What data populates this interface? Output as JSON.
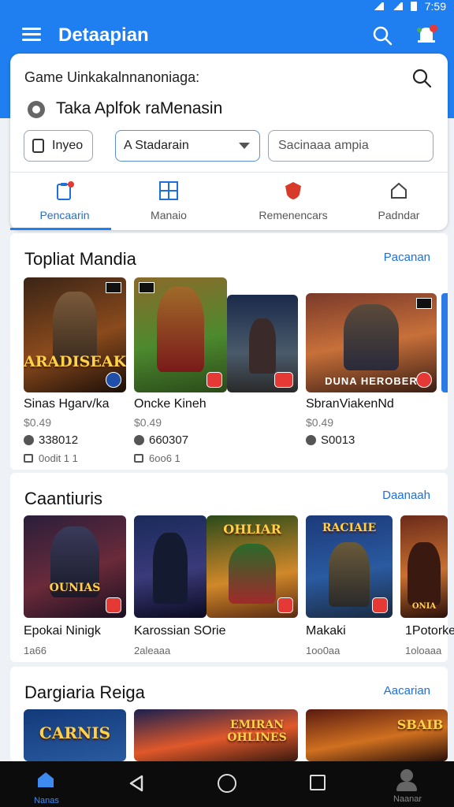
{
  "status_bar": {
    "time": "7:59"
  },
  "app_bar": {
    "title": "Detaapian"
  },
  "search": {
    "label": "Game Uinkakalnnanoniaga:",
    "subtitle": "Taka Aplfok raMenasin",
    "chip_1": "Inyeo",
    "select_value": "A Stadarain",
    "input_placeholder": "Sacinaaa ampia"
  },
  "tabs": [
    {
      "label": "Pencaarin",
      "icon": "clipboard-icon",
      "active": true
    },
    {
      "label": "Manaio",
      "icon": "grid-icon",
      "active": false
    },
    {
      "label": "Remenencars",
      "icon": "shield-icon",
      "active": false
    },
    {
      "label": "Padndar",
      "icon": "home-icon",
      "active": false
    }
  ],
  "sections": [
    {
      "title": "Topliat Mandia",
      "link": "Pacanan",
      "games": [
        {
          "name": "Sinas Hgarv/ka",
          "price": "$0.49",
          "rating": "338012",
          "downloads": "0odit 1 1",
          "art_text": "ARADISEAK",
          "colors": [
            "#2b1a12",
            "#c8762a"
          ]
        },
        {
          "name": "Oncke Kineh",
          "price": "$0.49",
          "rating": "660307",
          "downloads": "6oo6 1",
          "art_text": "",
          "colors": [
            "#4d8a2e",
            "#c04a1a"
          ]
        },
        {
          "name": "SbranViakenNd",
          "price": "$0.49",
          "rating": "S0013",
          "downloads": "",
          "art_text": "DUNA HEROBER",
          "colors": [
            "#5a3020",
            "#e08a40"
          ]
        }
      ]
    },
    {
      "title": "Caantiuris",
      "link": "Daanaah",
      "games": [
        {
          "name": "Epokai Ninigk",
          "meta": "1a66",
          "art_text": "OUNIAS",
          "colors": [
            "#1c1d3a",
            "#b0402a"
          ]
        },
        {
          "name": "Karossian SOrie",
          "meta": "2aleaaa",
          "art_text": "OHLIAR",
          "colors": [
            "#1b2b5a",
            "#e2b22a"
          ]
        },
        {
          "name": "Makaki",
          "meta": "1oo0aa",
          "art_text": "RACIAIE",
          "colors": [
            "#1c3a6a",
            "#d08a2a"
          ]
        },
        {
          "name": "1Potorke",
          "meta": "1oloaaa",
          "art_text": "ONIA",
          "colors": [
            "#6a2a1a",
            "#f0a040"
          ]
        }
      ]
    },
    {
      "title": "Dargiaria Reiga",
      "link": "Aacarian",
      "games": [
        {
          "art_text": "CARNIS",
          "colors": [
            "#123a6a",
            "#e8a02a"
          ]
        },
        {
          "art_text": "EMIRAN OHLINES",
          "colors": [
            "#1a2050",
            "#e0582a"
          ]
        },
        {
          "art_text": "SBAIB",
          "colors": [
            "#3a1a10",
            "#d07020"
          ]
        }
      ]
    }
  ],
  "bottom_nav": {
    "home_label": "Nanas",
    "profile_label": "Naanar"
  }
}
